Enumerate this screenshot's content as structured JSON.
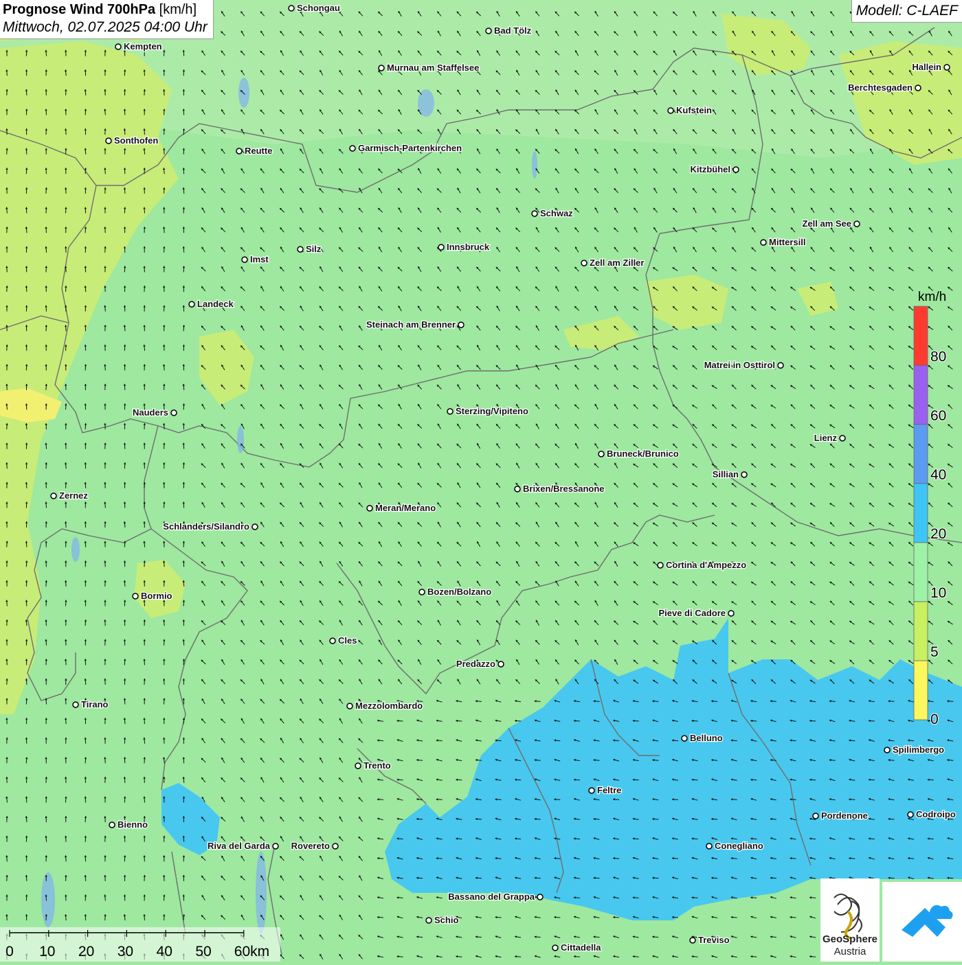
{
  "title": {
    "main_bold": "Prognose Wind 700hPa",
    "main_unit": "[km/h]",
    "date": "Mittwoch, 02.07.2025 04:00 Uhr"
  },
  "model": "Modell: C-LAEF",
  "legend": {
    "unit": "km/h",
    "labels": [
      "80",
      "60",
      "40",
      "20",
      "10",
      "5",
      "0"
    ],
    "colors": [
      "#ff3b30",
      "#9a60f0",
      "#5b9cf2",
      "#3ec5f5",
      "#9ef2a6",
      "#c8f060",
      "#fbf75c"
    ]
  },
  "scale_bar": {
    "labels": [
      "0",
      "10",
      "20",
      "30",
      "40",
      "50",
      "60km"
    ]
  },
  "logos": {
    "geosphere_line1": "GeoSphere",
    "geosphere_line2": "Austria"
  },
  "cities": [
    {
      "name": "Schongau"
    },
    {
      "name": "Bad Tölz"
    },
    {
      "name": "Kempten"
    },
    {
      "name": "Murnau am Staffelsee"
    },
    {
      "name": "Hallein"
    },
    {
      "name": "Berchtesgaden"
    },
    {
      "name": "Kufstein"
    },
    {
      "name": "Sonthofen"
    },
    {
      "name": "Reutte"
    },
    {
      "name": "Garmisch-Partenkirchen"
    },
    {
      "name": "Kitzbühel"
    },
    {
      "name": "Schwaz"
    },
    {
      "name": "Zell am See"
    },
    {
      "name": "Innsbruck"
    },
    {
      "name": "Mittersill"
    },
    {
      "name": "Silz"
    },
    {
      "name": "Imst"
    },
    {
      "name": "Zell am Ziller"
    },
    {
      "name": "Landeck"
    },
    {
      "name": "Steinach am Brenner"
    },
    {
      "name": "Matrei in Osttirol"
    },
    {
      "name": "Nauders"
    },
    {
      "name": "Sterzing/Vipiteno"
    },
    {
      "name": "Lienz"
    },
    {
      "name": "Bruneck/Brunico"
    },
    {
      "name": "Sillian"
    },
    {
      "name": "Brixen/Bressanone"
    },
    {
      "name": "Zernez"
    },
    {
      "name": "Meran/Merano"
    },
    {
      "name": "Schlanders/Silandro"
    },
    {
      "name": "Cortina d'Ampezzo"
    },
    {
      "name": "Bozen/Bolzano"
    },
    {
      "name": "Bormio"
    },
    {
      "name": "Pieve di Cadore"
    },
    {
      "name": "Cles"
    },
    {
      "name": "Predazzo"
    },
    {
      "name": "Tirano"
    },
    {
      "name": "Mezzolombardo"
    },
    {
      "name": "Belluno"
    },
    {
      "name": "Spilimbergo"
    },
    {
      "name": "Trento"
    },
    {
      "name": "Feltre"
    },
    {
      "name": "Pordenone"
    },
    {
      "name": "Codroipo"
    },
    {
      "name": "Bienno"
    },
    {
      "name": "Riva del Garda"
    },
    {
      "name": "Rovereto"
    },
    {
      "name": "Conegliano"
    },
    {
      "name": "Bassano del Grappa"
    },
    {
      "name": "Schio"
    },
    {
      "name": "Treviso"
    },
    {
      "name": "Cittadella"
    }
  ],
  "colors": {
    "base_green": "#9ee8a0",
    "light_green": "#b9f0a8",
    "yellow_green": "#cdeb72",
    "cyan_zone": "#45c8f0",
    "arrow": "#111111"
  }
}
